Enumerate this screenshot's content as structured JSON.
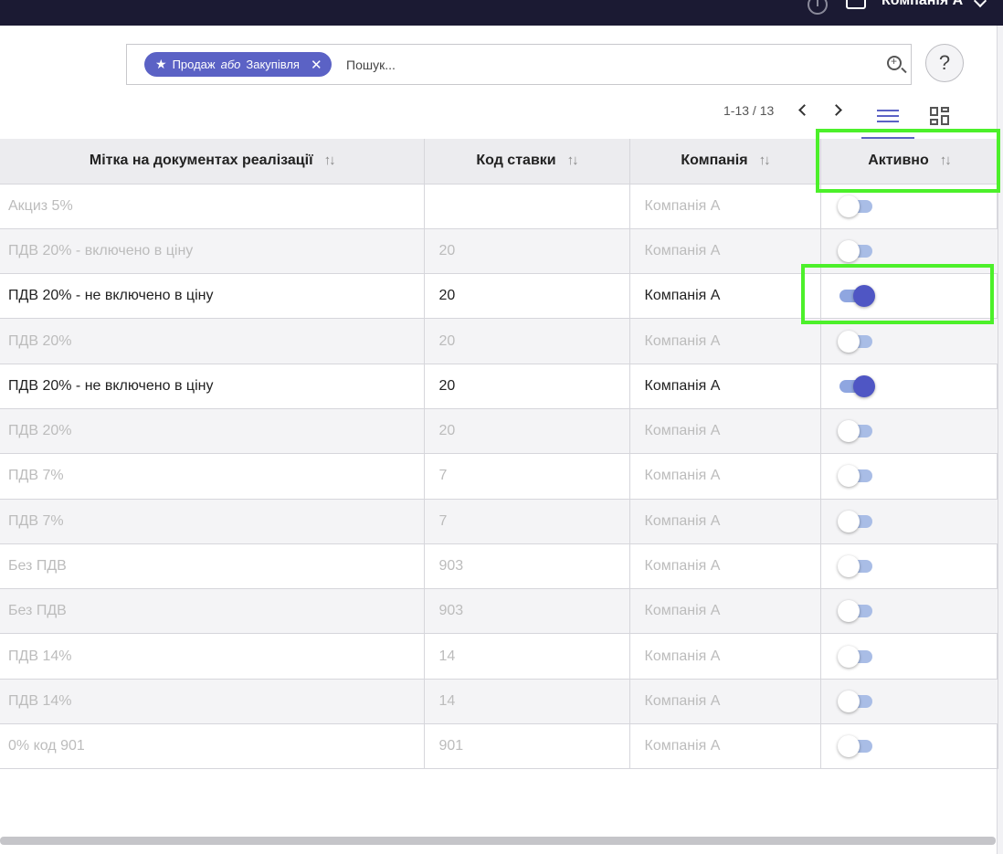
{
  "topbar": {
    "company": "Компанія А"
  },
  "search": {
    "facet_part1": "Продаж",
    "facet_or": "або",
    "facet_part2": "Закупівля",
    "placeholder": "Пошук..."
  },
  "help_label": "?",
  "pager": {
    "range": "1-13 / 13"
  },
  "columns": [
    {
      "label": "Мітка на документах реалізації"
    },
    {
      "label": "Код ставки"
    },
    {
      "label": "Компанія"
    },
    {
      "label": "Активно"
    }
  ],
  "rows": [
    {
      "label": "Акциз 5%",
      "code": "",
      "company": "Компанія А",
      "active": false
    },
    {
      "label": "ПДВ 20% - включено в ціну",
      "code": "20",
      "company": "Компанія А",
      "active": false
    },
    {
      "label": "ПДВ 20% - не включено в ціну",
      "code": "20",
      "company": "Компанія А",
      "active": true
    },
    {
      "label": "ПДВ 20%",
      "code": "20",
      "company": "Компанія А",
      "active": false
    },
    {
      "label": "ПДВ 20% - не включено в ціну",
      "code": "20",
      "company": "Компанія А",
      "active": true
    },
    {
      "label": "ПДВ 20%",
      "code": "20",
      "company": "Компанія А",
      "active": false
    },
    {
      "label": "ПДВ 7%",
      "code": "7",
      "company": "Компанія А",
      "active": false
    },
    {
      "label": "ПДВ 7%",
      "code": "7",
      "company": "Компанія А",
      "active": false
    },
    {
      "label": "Без ПДВ",
      "code": "903",
      "company": "Компанія А",
      "active": false
    },
    {
      "label": "Без ПДВ",
      "code": "903",
      "company": "Компанія А",
      "active": false
    },
    {
      "label": "ПДВ 14%",
      "code": "14",
      "company": "Компанія А",
      "active": false
    },
    {
      "label": "ПДВ 14%",
      "code": "14",
      "company": "Компанія А",
      "active": false
    },
    {
      "label": "0% код 901",
      "code": "901",
      "company": "Компанія А",
      "active": false
    }
  ],
  "colors": {
    "accent": "#5b62c5",
    "highlight": "#4cf02a",
    "topbar": "#1b1a33"
  }
}
